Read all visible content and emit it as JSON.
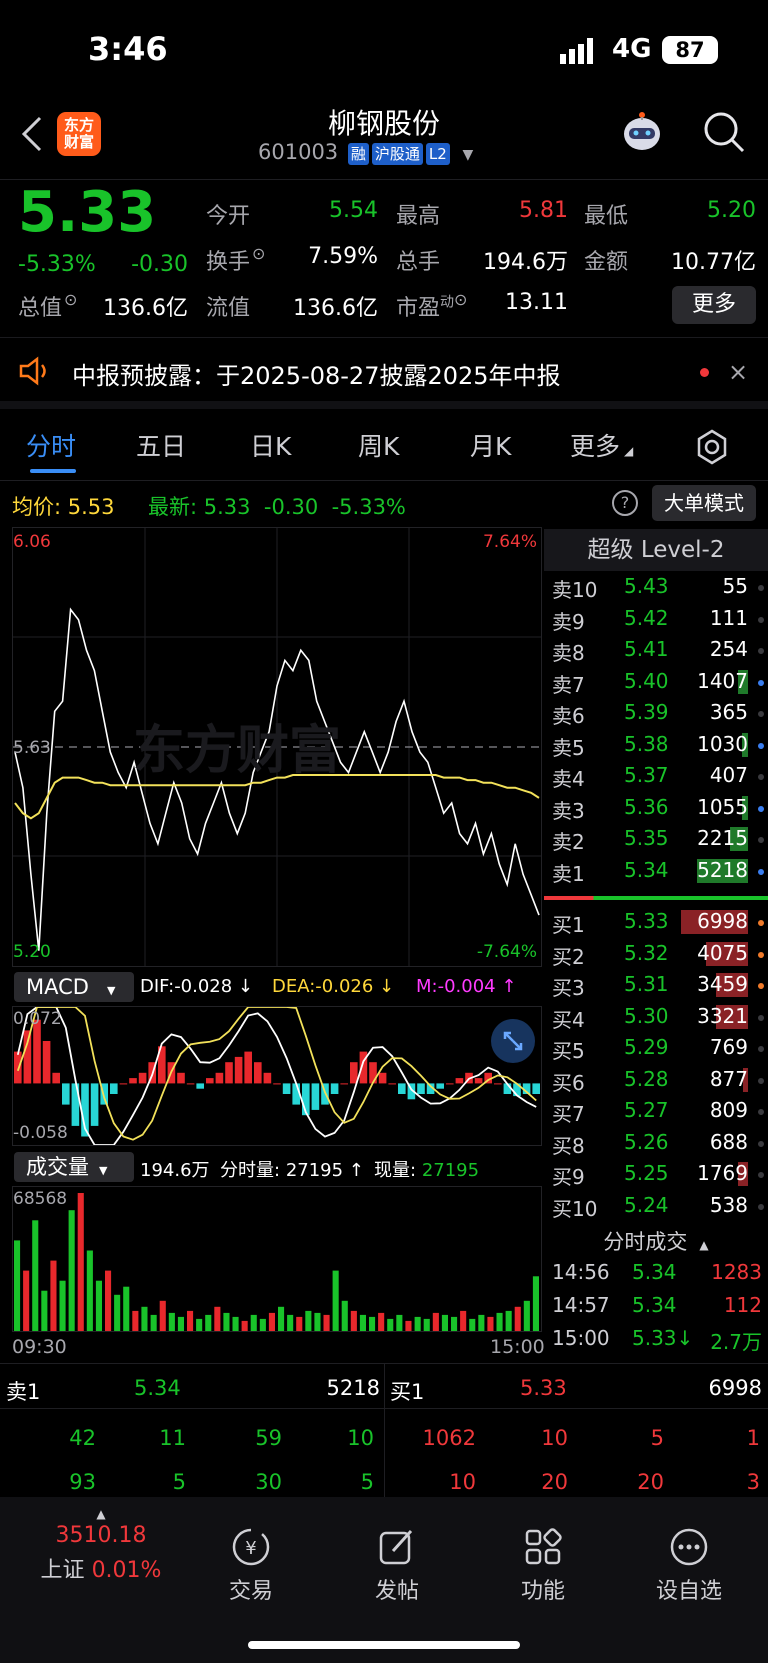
{
  "status_bar": {
    "time": "3:46",
    "network": "4G",
    "battery": "87"
  },
  "nav": {
    "logo": "东方\n财富",
    "title": "柳钢股份",
    "code": "601003",
    "tags": [
      "融",
      "沪股通",
      "L2"
    ]
  },
  "quote": {
    "price": "5.33",
    "change_pct": "-5.33%",
    "change": "-0.30",
    "open_label": "今开",
    "open": "5.54",
    "high_label": "最高",
    "high": "5.81",
    "low_label": "最低",
    "low": "5.20",
    "turnover_label": "换手",
    "turnover": "7.59%",
    "volume_label": "总手",
    "volume": "194.6万",
    "amount_label": "金额",
    "amount": "10.77亿",
    "mktcap_label": "总值",
    "mktcap": "136.6亿",
    "float_label": "流值",
    "float": "136.6亿",
    "pe_label": "市盈",
    "pe_sup": "动",
    "pe": "13.11",
    "more_button": "更多"
  },
  "notice": {
    "text": "中报预披露：于2025-08-27披露2025年中报"
  },
  "tabs": [
    "分时",
    "五日",
    "日K",
    "周K",
    "月K",
    "更多"
  ],
  "chart_info": {
    "avg_label": "均价:",
    "avg": "5.53",
    "latest_label": "最新:",
    "latest": "5.33",
    "latest_change": "-0.30",
    "latest_pct": "-5.33%",
    "mode_button": "大单模式",
    "price_high": "6.06",
    "price_low": "5.20",
    "price_mid": "5.63",
    "pct_high": "7.64%",
    "pct_low": "-7.64%",
    "time_start": "09:30",
    "time_end": "15:00",
    "watermark": "东方财富"
  },
  "macd": {
    "label": "MACD",
    "dif": "DIF:-0.028 ↓",
    "dea": "DEA:-0.026 ↓",
    "m": "M:-0.004 ↑",
    "top": "0.072",
    "bottom": "-0.058"
  },
  "volume_panel": {
    "label": "成交量",
    "total": "194.6万",
    "minute_label": "分时量:",
    "minute": "27195 ↑",
    "now_label": "现量:",
    "now": "27195",
    "max": "68568"
  },
  "order_book": {
    "title": "超级 Level-2",
    "asks": [
      {
        "label": "卖10",
        "price": "5.43",
        "vol": "55",
        "bar": 0
      },
      {
        "label": "卖9",
        "price": "5.42",
        "vol": "111",
        "bar": 0
      },
      {
        "label": "卖8",
        "price": "5.41",
        "vol": "254",
        "bar": 0
      },
      {
        "label": "卖7",
        "price": "5.40",
        "vol": "1407",
        "bar": 0.06,
        "dot": "#3a7ef0"
      },
      {
        "label": "卖6",
        "price": "5.39",
        "vol": "365",
        "bar": 0
      },
      {
        "label": "卖5",
        "price": "5.38",
        "vol": "1030",
        "bar": 0.04,
        "dot": "#3a7ef0"
      },
      {
        "label": "卖4",
        "price": "5.37",
        "vol": "407",
        "bar": 0
      },
      {
        "label": "卖3",
        "price": "5.36",
        "vol": "1055",
        "bar": 0.04,
        "dot": "#3a7ef0"
      },
      {
        "label": "卖2",
        "price": "5.35",
        "vol": "2215",
        "bar": 0.11
      },
      {
        "label": "卖1",
        "price": "5.34",
        "vol": "5218",
        "bar": 0.32,
        "dot": "#3a7ef0"
      }
    ],
    "bids": [
      {
        "label": "买1",
        "price": "5.33",
        "vol": "6998",
        "bar": 0.42,
        "dot": "#f07a2a"
      },
      {
        "label": "买2",
        "price": "5.32",
        "vol": "4075",
        "bar": 0.26,
        "dot": "#f07a2a"
      },
      {
        "label": "买3",
        "price": "5.31",
        "vol": "3459",
        "bar": 0.2,
        "dot": "#f07a2a"
      },
      {
        "label": "买4",
        "price": "5.30",
        "vol": "3321",
        "bar": 0.2
      },
      {
        "label": "买5",
        "price": "5.29",
        "vol": "769",
        "bar": 0
      },
      {
        "label": "买6",
        "price": "5.28",
        "vol": "877",
        "bar": 0.03
      },
      {
        "label": "买7",
        "price": "5.27",
        "vol": "809",
        "bar": 0
      },
      {
        "label": "买8",
        "price": "5.26",
        "vol": "688",
        "bar": 0
      },
      {
        "label": "买9",
        "price": "5.25",
        "vol": "1769",
        "bar": 0.06
      },
      {
        "label": "买10",
        "price": "5.24",
        "vol": "538",
        "bar": 0
      }
    ],
    "ticks_title": "分时成交",
    "ticks": [
      {
        "time": "14:56",
        "price": "5.34",
        "vol": "1283",
        "color": "red"
      },
      {
        "time": "14:57",
        "price": "5.34",
        "vol": "112",
        "color": "red"
      },
      {
        "time": "15:00",
        "price": "5.33↓",
        "vol": "2.7万",
        "color": "green"
      }
    ]
  },
  "depth": {
    "sell_label": "卖1",
    "sell_price": "5.34",
    "sell_vol": "5218",
    "buy_label": "买1",
    "buy_price": "5.33",
    "buy_vol": "6998",
    "sell_queue": [
      [
        "42",
        "11",
        "59",
        "10"
      ],
      [
        "93",
        "5",
        "30",
        "5"
      ]
    ],
    "buy_queue": [
      [
        "1062",
        "10",
        "5",
        "1"
      ],
      [
        "10",
        "20",
        "20",
        "3"
      ]
    ]
  },
  "bottom_nav": {
    "index_value": "3510.18",
    "index_name": "上证",
    "index_pct": "0.01%",
    "items": [
      "交易",
      "发帖",
      "功能",
      "设自选"
    ]
  },
  "chart_data": [
    {
      "type": "line",
      "title": "",
      "ylim": [
        5.2,
        6.06
      ],
      "x_range": [
        "09:30",
        "15:00"
      ],
      "series": [
        {
          "values": [
            5.62,
            5.55,
            5.38,
            5.23,
            5.5,
            5.7,
            5.72,
            5.9,
            5.88,
            5.82,
            5.78,
            5.7,
            5.62,
            5.58,
            5.55,
            5.6,
            5.54,
            5.48,
            5.44,
            5.5,
            5.56,
            5.52,
            5.45,
            5.42,
            5.48,
            5.52,
            5.56,
            5.5,
            5.46,
            5.5,
            5.58,
            5.62,
            5.66,
            5.75,
            5.8,
            5.78,
            5.82,
            5.8,
            5.72,
            5.68,
            5.64,
            5.6,
            5.58,
            5.62,
            5.66,
            5.62,
            5.58,
            5.62,
            5.68,
            5.72,
            5.66,
            5.62,
            5.6,
            5.55,
            5.5,
            5.52,
            5.46,
            5.44,
            5.48,
            5.42,
            5.46,
            5.4,
            5.36,
            5.44,
            5.38,
            5.34,
            5.3
          ]
        },
        {
          "values": [
            5.52,
            5.5,
            5.49,
            5.5,
            5.53,
            5.56,
            5.57,
            5.57,
            5.57,
            5.565,
            5.56,
            5.56,
            5.555,
            5.555,
            5.555,
            5.555,
            5.555,
            5.555,
            5.555,
            5.555,
            5.555,
            5.555,
            5.555,
            5.555,
            5.555,
            5.555,
            5.555,
            5.555,
            5.555,
            5.555,
            5.56,
            5.56,
            5.565,
            5.57,
            5.57,
            5.575,
            5.575,
            5.575,
            5.575,
            5.575,
            5.575,
            5.575,
            5.575,
            5.575,
            5.575,
            5.575,
            5.575,
            5.575,
            5.575,
            5.575,
            5.575,
            5.575,
            5.575,
            5.575,
            5.57,
            5.57,
            5.57,
            5.565,
            5.565,
            5.56,
            5.56,
            5.555,
            5.55,
            5.55,
            5.545,
            5.54,
            5.53
          ]
        }
      ]
    },
    {
      "type": "bar",
      "title": "",
      "ylim": [
        -0.058,
        0.072
      ],
      "values": [
        0.03,
        0.05,
        0.06,
        0.04,
        0.01,
        -0.02,
        -0.04,
        -0.05,
        -0.04,
        -0.02,
        -0.01,
        0.0,
        0.005,
        0.01,
        0.02,
        0.035,
        0.02,
        0.01,
        0.0,
        -0.005,
        0.005,
        0.01,
        0.02,
        0.025,
        0.03,
        0.02,
        0.01,
        0.0,
        -0.01,
        -0.02,
        -0.03,
        -0.025,
        -0.02,
        -0.01,
        0.0,
        0.02,
        0.03,
        0.02,
        0.01,
        0.0,
        -0.01,
        -0.015,
        -0.01,
        -0.01,
        -0.005,
        0.0,
        0.005,
        0.01,
        0.005,
        0.01,
        0.0,
        -0.01,
        -0.012,
        -0.01,
        -0.01
      ]
    },
    {
      "type": "bar",
      "title": "",
      "ylim": [
        0,
        68568
      ],
      "values": [
        45000,
        30000,
        55000,
        20000,
        35000,
        25000,
        60000,
        68568,
        40000,
        25000,
        30000,
        18000,
        22000,
        10000,
        12000,
        8000,
        15000,
        9000,
        7000,
        10000,
        6000,
        8000,
        12000,
        9000,
        7000,
        5000,
        8000,
        6000,
        9000,
        12000,
        8000,
        7000,
        10000,
        9000,
        8000,
        30000,
        15000,
        10000,
        8000,
        7000,
        9000,
        6000,
        8000,
        5000,
        7000,
        6000,
        9000,
        8000,
        7000,
        10000,
        6000,
        8000,
        7000,
        9000,
        10000,
        12000,
        15000,
        27195
      ]
    }
  ]
}
